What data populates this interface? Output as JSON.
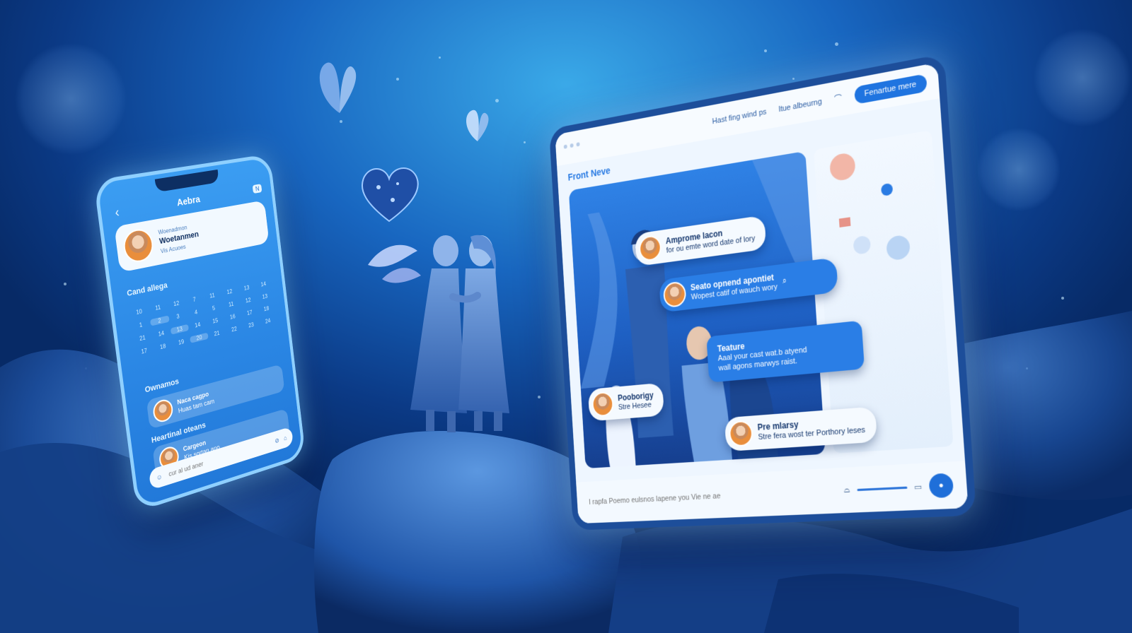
{
  "phone": {
    "title": "Aebra",
    "badge": "N",
    "profile": {
      "line1": "Woenadmon",
      "line2": "Woetanmen",
      "line3": "Vis Acuoes"
    },
    "calendar_label": "Cand allega",
    "calendar_days": [
      "10",
      "11",
      "12",
      "7",
      "11",
      "12",
      "13",
      "14",
      "1",
      "2",
      "3",
      "4",
      "5",
      "11",
      "12",
      "13",
      "21",
      "14",
      "13",
      "14",
      "15",
      "16",
      "17",
      "18",
      "17",
      "18",
      "19",
      "20",
      "21",
      "22",
      "23",
      "24"
    ],
    "conversations_label": "Ownamos",
    "convo1": {
      "name": "Naca cagpo",
      "sub": "Huas tam cam"
    },
    "recent_label": "Heartinal oteans",
    "convo2": {
      "name": "Cargeon",
      "sub": "Kis sortan ano"
    },
    "input_placeholder": "cur al ud aner"
  },
  "tablet": {
    "nav_item1": "Hast fing wind ps",
    "nav_item2": "Itue albeurng",
    "nav_button": "Fenartue mere",
    "heading": "Front Neve",
    "bubble1": {
      "name": "Amprome lacon",
      "text": "for ou emte word date of lory"
    },
    "bubble2": {
      "name": "Seato opnend apontiet",
      "text": "Wopest catif of wauch wory"
    },
    "bubble3": {
      "title": "Teature",
      "line1": "Aaal your cast wat.b atyend",
      "line2": "wall agons marwys raist."
    },
    "bubble4": {
      "name": "Pooborigy",
      "text": "Stre Hesee"
    },
    "bubble5": {
      "name": "Pre mlarsy",
      "text": "Stre fera wost ter Porthory leses"
    },
    "footer_placeholder": "I rapfa Poemo eulsnos lapene you Vie ne ae"
  },
  "colors": {
    "background": "#1866c0",
    "phone_body": "#3b9df2",
    "tablet_accent": "#1f74e0"
  }
}
